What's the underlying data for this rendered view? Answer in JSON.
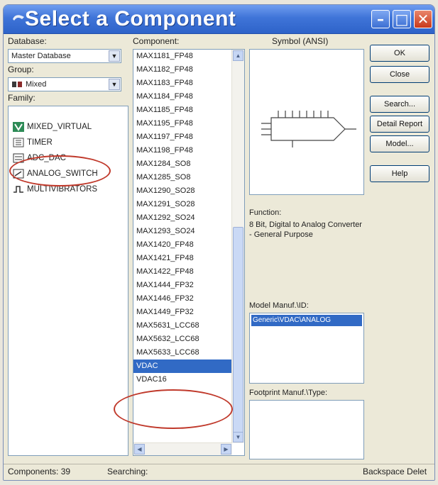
{
  "window": {
    "title": "Select a Component"
  },
  "labels": {
    "database": "Database:",
    "group": "Group:",
    "family": "Family:",
    "component": "Component:",
    "symbol": "Symbol (ANSI)",
    "function": "Function:",
    "model": "Model Manuf.\\ID:",
    "footprint": "Footprint Manuf.\\Type:"
  },
  "database": {
    "value": "Master Database"
  },
  "group": {
    "value": "Mixed"
  },
  "family": {
    "items": [
      {
        "label": "MIXED_VIRTUAL",
        "icon": "mixed-virtual-icon"
      },
      {
        "label": "TIMER",
        "icon": "timer-icon"
      },
      {
        "label": "ADC_DAC",
        "icon": "adc-dac-icon"
      },
      {
        "label": "ANALOG_SWITCH",
        "icon": "analog-switch-icon"
      },
      {
        "label": "MULTIVIBRATORS",
        "icon": "multivibrator-icon"
      }
    ]
  },
  "components": {
    "items": [
      "MAX1181_FP48",
      "MAX1182_FP48",
      "MAX1183_FP48",
      "MAX1184_FP48",
      "MAX1185_FP48",
      "MAX1195_FP48",
      "MAX1197_FP48",
      "MAX1198_FP48",
      "MAX1284_SO8",
      "MAX1285_SO8",
      "MAX1290_SO28",
      "MAX1291_SO28",
      "MAX1292_SO24",
      "MAX1293_SO24",
      "MAX1420_FP48",
      "MAX1421_FP48",
      "MAX1422_FP48",
      "MAX1444_FP32",
      "MAX1446_FP32",
      "MAX1449_FP32",
      "MAX5631_LCC68",
      "MAX5632_LCC68",
      "MAX5633_LCC68",
      "VDAC",
      "VDAC16"
    ],
    "selected": "VDAC"
  },
  "function": {
    "text": "8 Bit, Digital to Analog Converter - General Purpose"
  },
  "model": {
    "value": "Generic\\VDAC\\ANALOG"
  },
  "buttons": {
    "ok": "OK",
    "close": "Close",
    "search": "Search...",
    "detail_report": "Detail Report",
    "model": "Model...",
    "help": "Help"
  },
  "status": {
    "components": "Components: 39",
    "searching": "Searching:",
    "right": "Backspace Delet"
  },
  "colors": {
    "title_bar": "#3f74d8",
    "selection": "#316ac5",
    "highlight_circle": "#c0392b"
  }
}
